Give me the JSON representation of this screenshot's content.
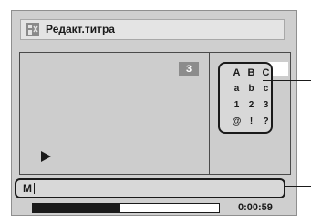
{
  "window": {
    "title": "Редакт.титра",
    "icon": "title-edit-icon"
  },
  "preview": {
    "page_number": "3",
    "play_icon": "play-icon"
  },
  "char_panel": {
    "selection_icon": "checkmark-icon",
    "rows": [
      [
        "A",
        "B",
        "C"
      ],
      [
        "a",
        "b",
        "c"
      ],
      [
        "1",
        "2",
        "3"
      ],
      [
        "@",
        "!",
        "?"
      ]
    ],
    "selected": "A"
  },
  "title_input": {
    "value": "M"
  },
  "playback": {
    "progress": 0.47,
    "time": "0:00:59"
  },
  "colors": {
    "background": "#cfcfcf",
    "accent": "#1a1a1a",
    "badge": "#8c8c8c"
  }
}
